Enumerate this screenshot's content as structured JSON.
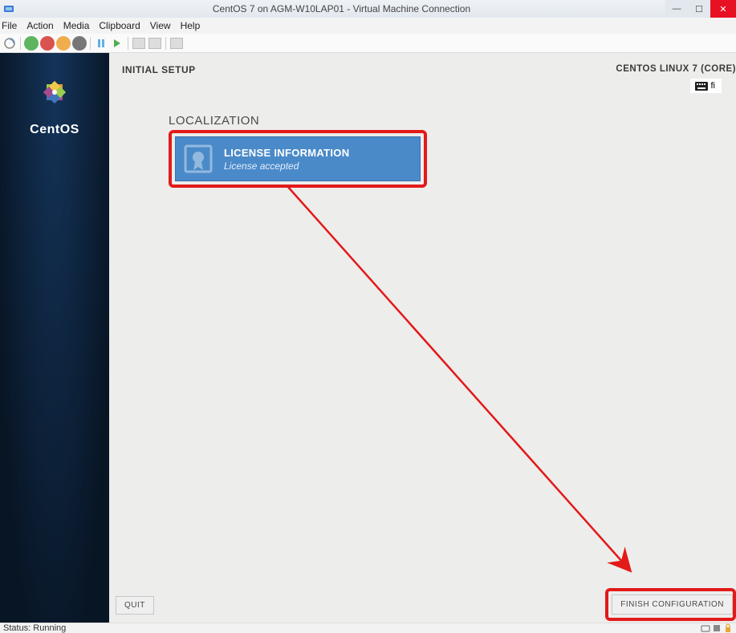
{
  "titlebar": {
    "title": "CentOS 7 on AGM-W10LAP01 - Virtual Machine Connection"
  },
  "menubar": [
    "File",
    "Action",
    "Media",
    "Clipboard",
    "View",
    "Help"
  ],
  "sidebar": {
    "brand": "CentOS"
  },
  "header": {
    "title": "INITIAL SETUP",
    "distro": "CENTOS LINUX 7 (CORE)",
    "kbd_layout": "fi"
  },
  "section": {
    "title": "LOCALIZATION"
  },
  "tile": {
    "title": "LICENSE INFORMATION",
    "subtitle": "License accepted"
  },
  "buttons": {
    "quit": "QUIT",
    "finish": "FINISH CONFIGURATION"
  },
  "status": {
    "text": "Status: Running"
  },
  "colors": {
    "accent": "#4a8ac9",
    "annotation": "#e21a1a",
    "sidebar": "#081524"
  }
}
